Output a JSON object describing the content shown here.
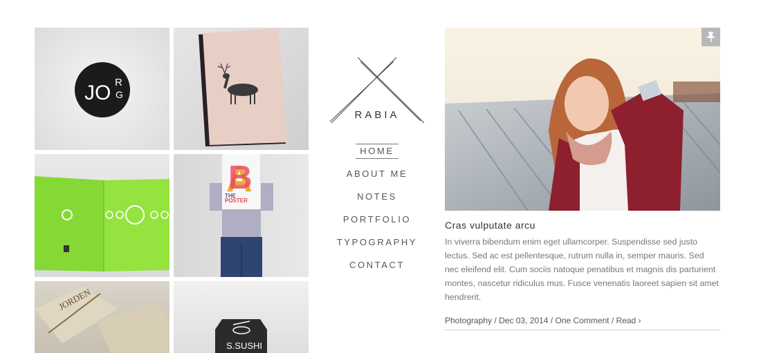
{
  "brand": {
    "name": "RABIA"
  },
  "nav": {
    "items": [
      {
        "label": "HOME",
        "active": true
      },
      {
        "label": "ABOUT ME",
        "active": false
      },
      {
        "label": "NOTES",
        "active": false
      },
      {
        "label": "PORTFOLIO",
        "active": false
      },
      {
        "label": "TYPOGRAPHY",
        "active": false
      },
      {
        "label": "CONTACT",
        "active": false
      }
    ]
  },
  "portfolio": {
    "tiles": [
      {
        "art_text": [
          "JO",
          "R",
          "G"
        ]
      },
      {
        "art_text": []
      },
      {
        "art_text": []
      },
      {
        "art_text": [
          "THE",
          "POSTER"
        ]
      },
      {
        "art_text": [
          "JORDEN"
        ]
      },
      {
        "art_text": [
          "S.SUSHI"
        ]
      }
    ]
  },
  "post": {
    "title": "Cras vulputate arcu",
    "excerpt": "In viverra bibendum enim eget ullamcorper. Suspendisse sed justo lectus. Sed ac est pellentesque, rutrum nulla in, semper mauris. Sed nec eleifend elit. Cum sociis natoque penatibus et magnis dis parturient montes, nascetur ridiculus mus. Fusce venenatis laoreet sapien sit amet hendrerit.",
    "category": "Photography",
    "date": "Dec 03, 2014",
    "comments": "One Comment",
    "read": "Read ›",
    "separator": " / "
  },
  "colors": {
    "accent_green": "#8ee33a",
    "pin_bg": "#b8b8b8",
    "text": "#777777"
  }
}
